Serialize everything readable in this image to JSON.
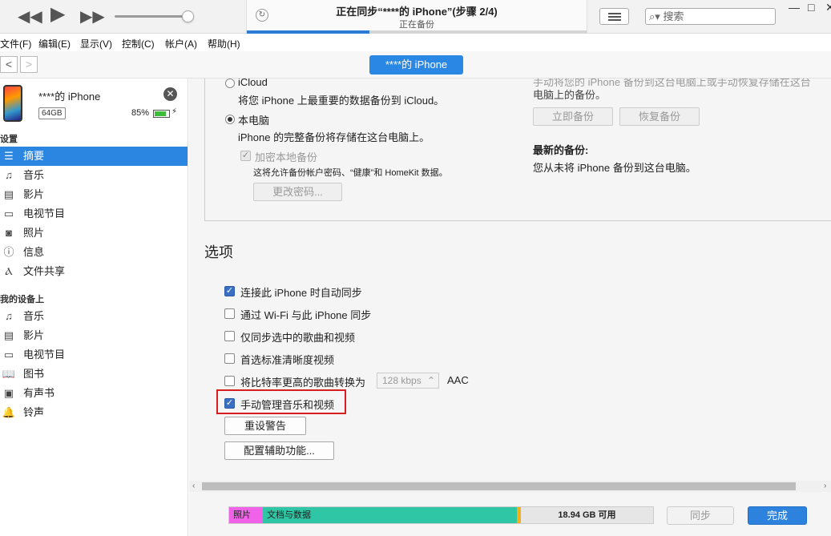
{
  "titlebar": {
    "lcd_title": "正在同步“****的 iPhone”(步骤 2/4)",
    "lcd_subtitle": "正在备份",
    "lcd_progress": 0.36,
    "search_placeholder": "搜索",
    "controls": {
      "minimize": "—",
      "maximize": "□",
      "close": "✕"
    }
  },
  "menu": [
    "文件(F)",
    "编辑(E)",
    "显示(V)",
    "控制(C)",
    "帐户(A)",
    "帮助(H)"
  ],
  "nav": {
    "back": "<",
    "forward": ">",
    "device_pill": "****的 iPhone"
  },
  "device": {
    "name": "****的 iPhone",
    "capacity": "64GB",
    "battery": "85%",
    "battery_level": 0.85
  },
  "sidebar": {
    "settings_header": "设置",
    "settings_items": [
      {
        "label": "摘要",
        "icon": "list-icon"
      },
      {
        "label": "音乐",
        "icon": "music-note-icon"
      },
      {
        "label": "影片",
        "icon": "film-icon"
      },
      {
        "label": "电视节目",
        "icon": "tv-icon"
      },
      {
        "label": "照片",
        "icon": "camera-icon"
      },
      {
        "label": "信息",
        "icon": "info-icon"
      },
      {
        "label": "文件共享",
        "icon": "app-store-icon"
      }
    ],
    "mydevice_header": "我的设备上",
    "mydevice_items": [
      {
        "label": "音乐",
        "icon": "music-note-icon"
      },
      {
        "label": "影片",
        "icon": "film-icon"
      },
      {
        "label": "电视节目",
        "icon": "tv-icon"
      },
      {
        "label": "图书",
        "icon": "book-icon"
      },
      {
        "label": "有声书",
        "icon": "audiobook-icon"
      },
      {
        "label": "铃声",
        "icon": "bell-icon"
      }
    ]
  },
  "backup": {
    "icloud_label": "iCloud",
    "icloud_desc": "将您 iPhone 上最重要的数据备份到 iCloud。",
    "local_label": "本电脑",
    "local_desc": "iPhone 的完整备份将存储在这台电脑上。",
    "encrypt_label": "加密本地备份",
    "encrypt_desc": "这将允许备份帐户密码、“健康”和 HomeKit 数据。",
    "change_password": "更改密码...",
    "right_desc_1": "手动将您的 iPhone 备份到这台电脑上或手动恢复存储在这台",
    "right_desc_2": "电脑上的备份。",
    "backup_now": "立即备份",
    "restore_backup": "恢复备份",
    "latest_title": "最新的备份:",
    "latest_desc": "您从未将 iPhone 备份到这台电脑。"
  },
  "options": {
    "title": "选项",
    "items": [
      {
        "label": "连接此 iPhone 时自动同步",
        "checked": true
      },
      {
        "label": "通过 Wi-Fi 与此 iPhone 同步",
        "checked": false
      },
      {
        "label": "仅同步选中的歌曲和视频",
        "checked": false
      },
      {
        "label": "首选标准清晰度视频",
        "checked": false
      },
      {
        "label": "将比特率更高的歌曲转换为",
        "checked": false
      },
      {
        "label": "手动管理音乐和视频",
        "checked": true
      }
    ],
    "bitrate_value": "128 kbps",
    "bitrate_format": "AAC",
    "reset_warnings": "重设警告",
    "accessibility": "配置辅助功能..."
  },
  "footer": {
    "storage": [
      {
        "label": "照片",
        "fraction": 0.08,
        "color": "#f063e8"
      },
      {
        "label": "文档与数据",
        "fraction": 0.6,
        "color": "#2ec6a4"
      },
      {
        "label": "",
        "fraction": 0.01,
        "color": "#f2b01e"
      }
    ],
    "free_label": "18.94 GB 可用",
    "sync": "同步",
    "done": "完成"
  }
}
